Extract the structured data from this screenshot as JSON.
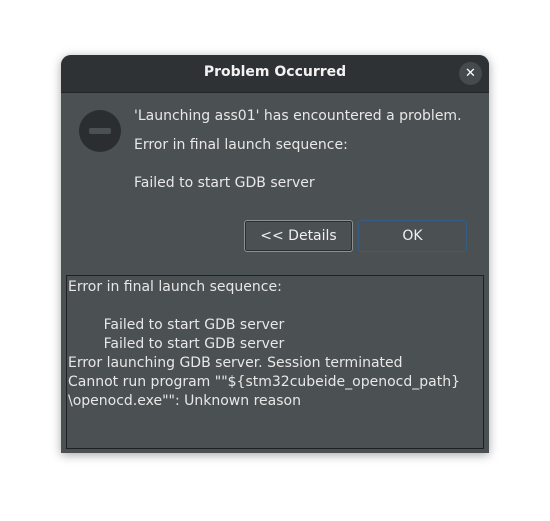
{
  "dialog": {
    "title": "Problem Occurred",
    "close_icon": "close-icon",
    "status_icon": "error-stop-icon",
    "message_title": "'Launching ass01' has encountered a problem.",
    "message_line1": "Error in final launch sequence:",
    "message_line2": "Failed to start GDB server",
    "details_button_label": "<< Details",
    "ok_button_label": "OK",
    "details_lines": [
      "Error in final launch sequence:",
      "",
      "        Failed to start GDB server",
      "        Failed to start GDB server",
      "Error launching GDB server. Session terminated",
      "Cannot run program \"\"${stm32cubeide_openocd_path}",
      "\\openocd.exe\"\": Unknown reason"
    ]
  },
  "colors": {
    "dialog_bg": "#4b5052",
    "titlebar_bg": "#2f3234",
    "ok_border": "#355e82",
    "text": "#e8e8e8"
  }
}
